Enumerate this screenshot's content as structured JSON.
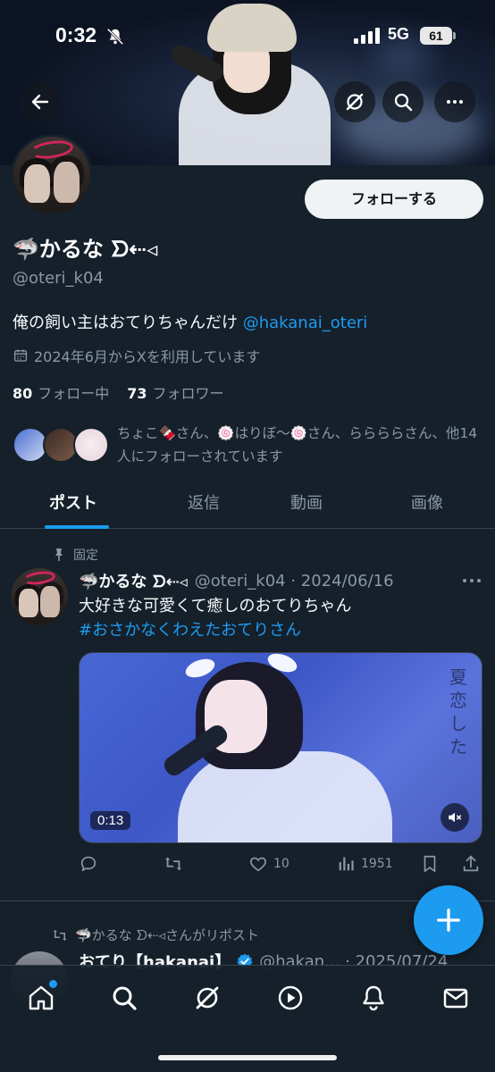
{
  "status_bar": {
    "time": "0:32",
    "network": "5G",
    "battery": "61"
  },
  "profile": {
    "display_name": "🦈かるな ᗤ⇠◃",
    "handle": "@oteri_k04",
    "follow_button": "フォローする",
    "bio_text": "俺の飼い主はおてりちゃんだけ ",
    "bio_mention": "@hakanai_oteri",
    "joined": "2024年6月からXを利用しています",
    "following_count": "80",
    "following_label": "フォロー中",
    "followers_count": "73",
    "followers_label": "フォロワー",
    "followed_by": "ちょこ🍫さん、🍥はりぼ〜🍥さん、ららららさん、他14人にフォローされています"
  },
  "tabs": [
    {
      "label": "ポスト"
    },
    {
      "label": "返信"
    },
    {
      "label": "動画"
    },
    {
      "label": "画像"
    }
  ],
  "pinned_post": {
    "pinned_label": "固定",
    "name": "🦈かるな ᗤ⇠◃",
    "meta": "@oteri_k04 · 2024/06/16",
    "text": "大好きな可愛くて癒しのおてりちゃん",
    "hashtag": "#おさかなくわえたおてりさん",
    "video_caption": "夏恋した",
    "video_duration": "0:13",
    "likes": "10",
    "views": "1951"
  },
  "repost": {
    "label": "🦈かるな ᗤ⇠◃さんがリポスト",
    "name": "おてり【hakanai】",
    "meta": "@hakan... · 2025/07/24"
  },
  "colors": {
    "background": "#15202b",
    "accent": "#1d9bf0",
    "secondary_text": "#8b98a5"
  },
  "icons": {
    "back": "arrow-left-icon",
    "grok": "grok-icon",
    "search": "search-icon",
    "more": "more-icon",
    "fab": "plus-icon",
    "nav": [
      "home-icon",
      "search-icon",
      "grok-icon",
      "video-icon",
      "bell-icon",
      "mail-icon"
    ]
  }
}
